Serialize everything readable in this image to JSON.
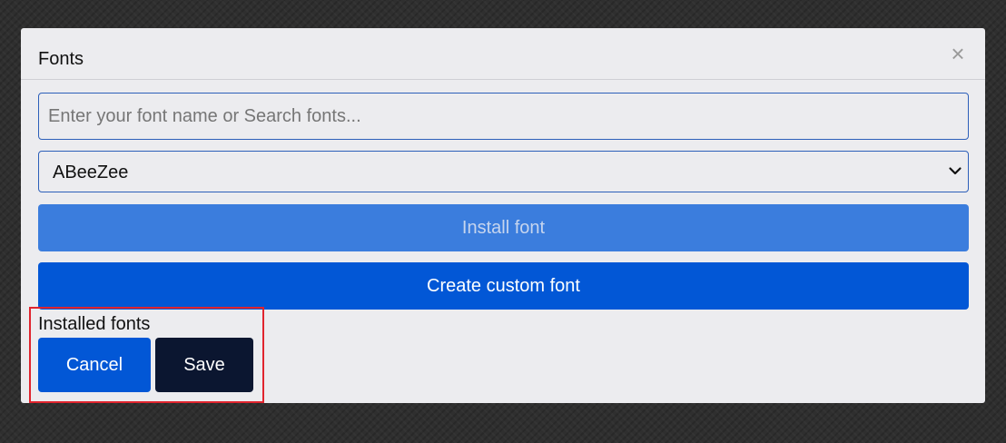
{
  "modal": {
    "title": "Fonts",
    "close_icon": "close-icon"
  },
  "search": {
    "placeholder": "Enter your font name or Search fonts...",
    "value": ""
  },
  "font_select": {
    "selected": "ABeeZee",
    "icon": "chevron-down-icon"
  },
  "buttons": {
    "install": "Install font",
    "create_custom": "Create custom font",
    "cancel": "Cancel",
    "save": "Save"
  },
  "installed_fonts_label": "Installed fonts",
  "colors": {
    "primary": "#0257d6",
    "primary_disabled": "#3b7ddd",
    "dark": "#0b1630",
    "modal_bg": "#ececef",
    "highlight": "#e0242e"
  }
}
